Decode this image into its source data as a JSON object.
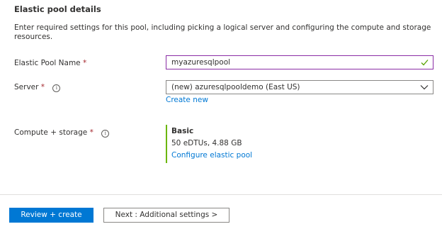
{
  "section": {
    "title": "Elastic pool details",
    "description": "Enter required settings for this pool, including picking a logical server and configuring the compute and storage resources."
  },
  "fields": {
    "pool_name": {
      "label": "Elastic Pool Name",
      "required_mark": "*",
      "value": "myazuresqlpool",
      "valid": true
    },
    "server": {
      "label": "Server",
      "required_mark": "*",
      "info_icon": "i",
      "value": "(new) azuresqlpooldemo (East US)",
      "create_new_link": "Create new"
    },
    "compute_storage": {
      "label": "Compute + storage",
      "required_mark": "*",
      "info_icon": "i",
      "tier": "Basic",
      "detail": "50 eDTUs, 4.88 GB",
      "configure_link": "Configure elastic pool"
    }
  },
  "footer": {
    "primary_button": "Review + create",
    "secondary_button": "Next : Additional settings >"
  },
  "colors": {
    "accent": "#0078d4",
    "required": "#a4262c",
    "valid_check": "#57a300",
    "tier_bar": "#6bb700",
    "focused_border": "#8a2da5"
  }
}
